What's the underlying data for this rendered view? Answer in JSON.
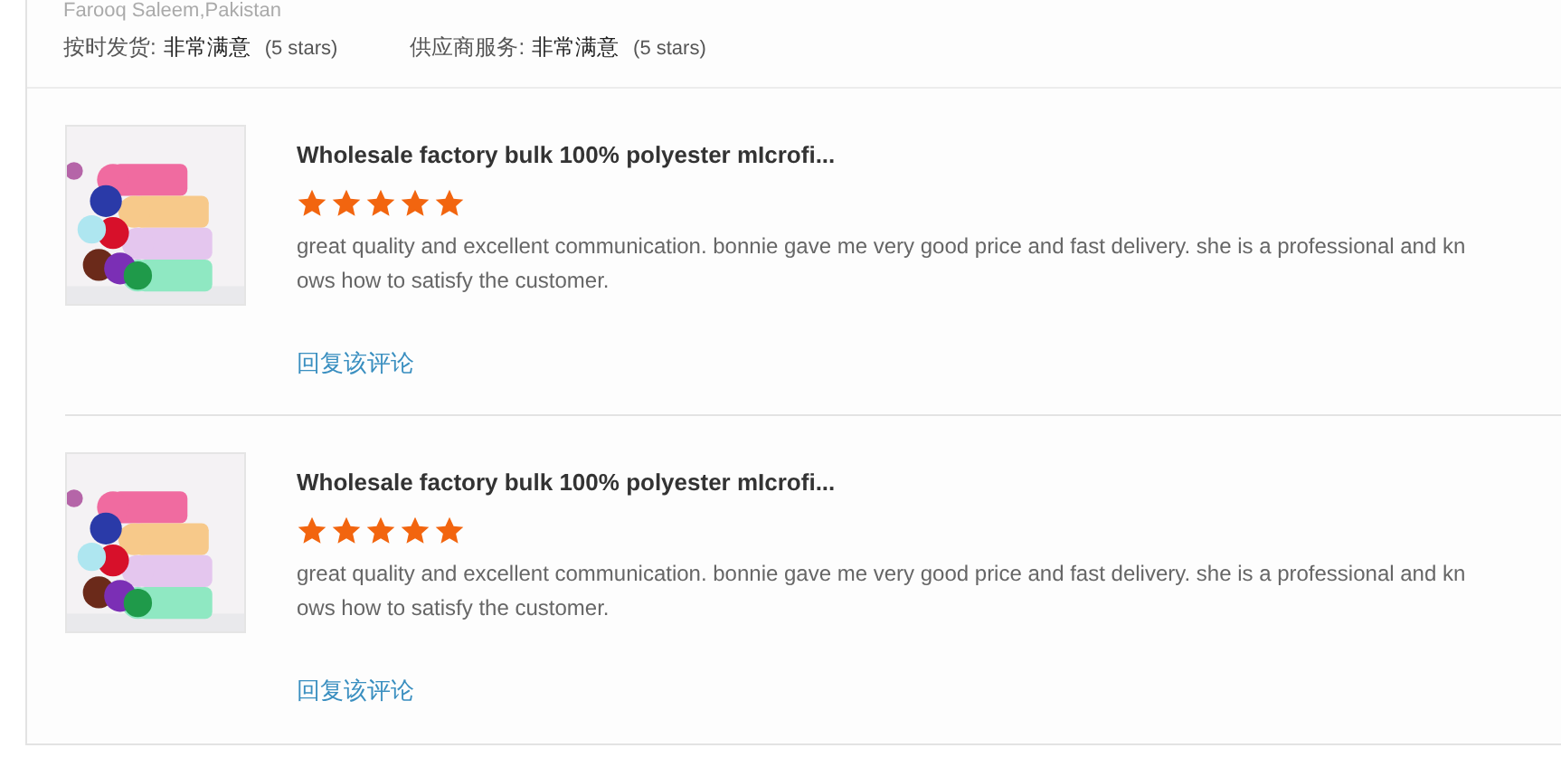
{
  "reviewer": "Farooq Saleem,Pakistan",
  "ratings": [
    {
      "label": "按时发货:",
      "value": "非常满意",
      "stars_text": "(5 stars)"
    },
    {
      "label": "供应商服务:",
      "value": "非常满意",
      "stars_text": "(5 stars)"
    }
  ],
  "reviews": [
    {
      "kind": "picture",
      "title": "Wholesale factory bulk 100% polyester mIcrofi...",
      "stars": 5,
      "text": "great quality and excellent communication. bonnie gave me very good price and fast delivery. she is a professional and knows how to satisfy the customer.",
      "reply_link": "回复该评论"
    },
    {
      "kind": "picture",
      "title": "Wholesale factory bulk 100% polyester mIcrofi...",
      "stars": 5,
      "text": "great quality and excellent communication. bonnie gave me very good price and fast delivery. she is a professional and knows how to satisfy the customer.",
      "reply_link": "回复该评论"
    }
  ]
}
